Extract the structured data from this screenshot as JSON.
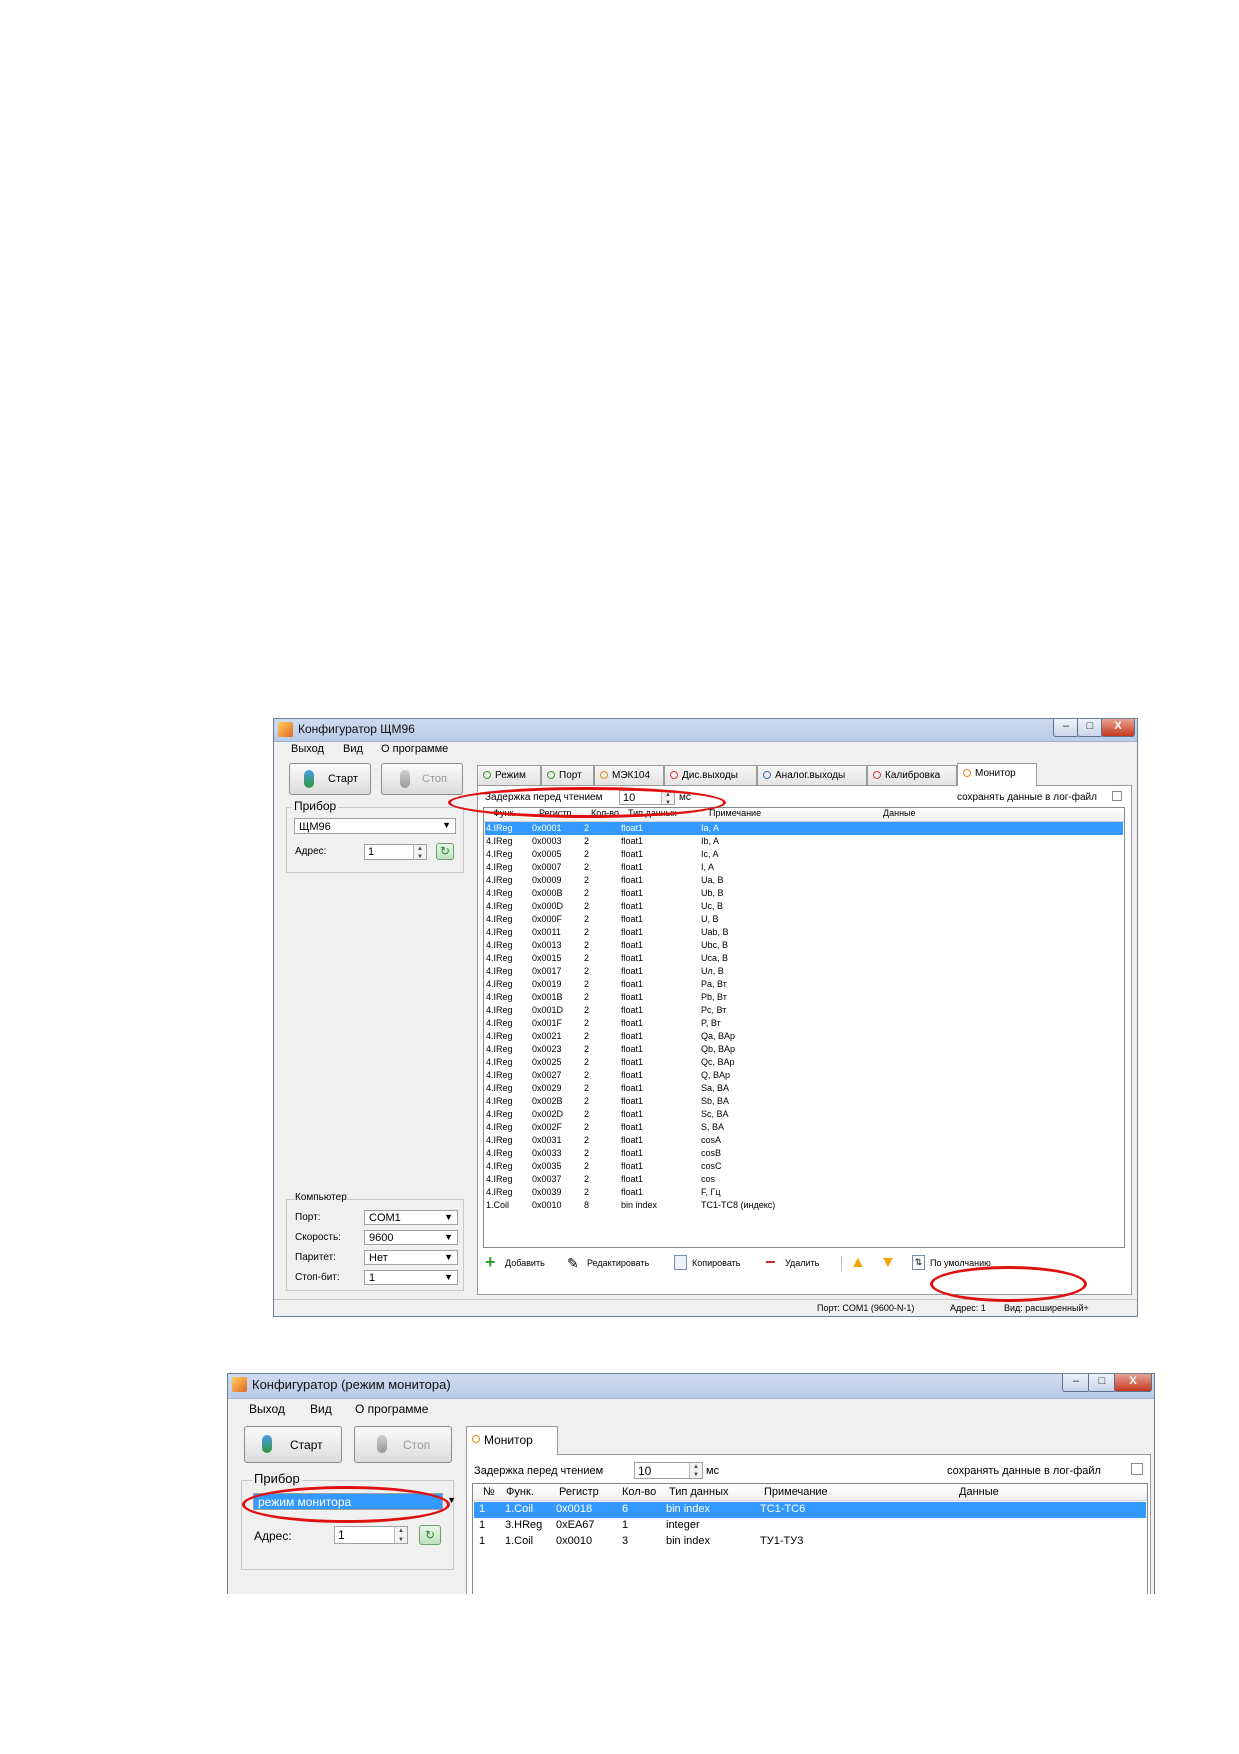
{
  "window1": {
    "title": "Конфигуратор ЩМ96",
    "controls": {
      "minimize": "–",
      "maximize": "□",
      "close": "X"
    },
    "menu": [
      "Выход",
      "Вид",
      "О программе"
    ],
    "start_label": "Старт",
    "stop_label": "Стоп",
    "device_group": "Прибор",
    "device_value": "ЩМ96",
    "address_label": "Адрес:",
    "address_value": "1",
    "computer_group": "Компьютер",
    "port_label": "Порт:",
    "port_value": "COM1",
    "speed_label": "Скорость:",
    "speed_value": "9600",
    "parity_label": "Паритет:",
    "parity_value": "Нет",
    "stopbits_label": "Стоп-бит:",
    "stopbits_value": "1",
    "tabs": [
      "Режим",
      "Порт",
      "МЭК104",
      "Дис.выходы",
      "Аналог.выходы",
      "Калибровка",
      "Монитор"
    ],
    "delay_label": "Задержка перед чтением",
    "delay_value": "10",
    "delay_unit": "мс",
    "savelog_label": "сохранять данные в лог-файл",
    "columns": [
      "Функ.",
      "Регистр",
      "Кол-во",
      "Тип данных",
      "Примечание",
      "Данные"
    ],
    "rows": [
      [
        "4.IReg",
        "0x0001",
        "2",
        "float1",
        "Ia, A",
        ""
      ],
      [
        "4.IReg",
        "0x0003",
        "2",
        "float1",
        "Ib, A",
        ""
      ],
      [
        "4.IReg",
        "0x0005",
        "2",
        "float1",
        "Ic, A",
        ""
      ],
      [
        "4.IReg",
        "0x0007",
        "2",
        "float1",
        "I, A",
        ""
      ],
      [
        "4.IReg",
        "0x0009",
        "2",
        "float1",
        "Ua, B",
        ""
      ],
      [
        "4.IReg",
        "0x000B",
        "2",
        "float1",
        "Ub, B",
        ""
      ],
      [
        "4.IReg",
        "0x000D",
        "2",
        "float1",
        "Uc, B",
        ""
      ],
      [
        "4.IReg",
        "0x000F",
        "2",
        "float1",
        "U, B",
        ""
      ],
      [
        "4.IReg",
        "0x0011",
        "2",
        "float1",
        "Uab, B",
        ""
      ],
      [
        "4.IReg",
        "0x0013",
        "2",
        "float1",
        "Ubc, B",
        ""
      ],
      [
        "4.IReg",
        "0x0015",
        "2",
        "float1",
        "Uca, B",
        ""
      ],
      [
        "4.IReg",
        "0x0017",
        "2",
        "float1",
        "Uл, B",
        ""
      ],
      [
        "4.IReg",
        "0x0019",
        "2",
        "float1",
        "Pa, Вт",
        ""
      ],
      [
        "4.IReg",
        "0x001B",
        "2",
        "float1",
        "Pb, Вт",
        ""
      ],
      [
        "4.IReg",
        "0x001D",
        "2",
        "float1",
        "Pc, Вт",
        ""
      ],
      [
        "4.IReg",
        "0x001F",
        "2",
        "float1",
        "P, Вт",
        ""
      ],
      [
        "4.IReg",
        "0x0021",
        "2",
        "float1",
        "Qa, BAp",
        ""
      ],
      [
        "4.IReg",
        "0x0023",
        "2",
        "float1",
        "Qb, BAp",
        ""
      ],
      [
        "4.IReg",
        "0x0025",
        "2",
        "float1",
        "Qc, BAp",
        ""
      ],
      [
        "4.IReg",
        "0x0027",
        "2",
        "float1",
        "Q, BAp",
        ""
      ],
      [
        "4.IReg",
        "0x0029",
        "2",
        "float1",
        "Sa, BA",
        ""
      ],
      [
        "4.IReg",
        "0x002B",
        "2",
        "float1",
        "Sb, BA",
        ""
      ],
      [
        "4.IReg",
        "0x002D",
        "2",
        "float1",
        "Sc, BA",
        ""
      ],
      [
        "4.IReg",
        "0x002F",
        "2",
        "float1",
        "S, BA",
        ""
      ],
      [
        "4.IReg",
        "0x0031",
        "2",
        "float1",
        "cosA",
        ""
      ],
      [
        "4.IReg",
        "0x0033",
        "2",
        "float1",
        "cosB",
        ""
      ],
      [
        "4.IReg",
        "0x0035",
        "2",
        "float1",
        "cosC",
        ""
      ],
      [
        "4.IReg",
        "0x0037",
        "2",
        "float1",
        "cos",
        ""
      ],
      [
        "4.IReg",
        "0x0039",
        "2",
        "float1",
        "F, Гц",
        ""
      ],
      [
        "1.Coil",
        "0x0010",
        "8",
        "bin index",
        "TC1-TC8 (индекс)",
        ""
      ]
    ],
    "selected_row": 0,
    "toolbar": {
      "add": "Добавить",
      "edit": "Редактировать",
      "copy": "Копировать",
      "delete": "Удалить",
      "default": "По умолчанию"
    },
    "status": {
      "port": "Порт: COM1 (9600-N-1)",
      "address": "Адрес: 1",
      "view": "Вид: расширенный+"
    }
  },
  "window2": {
    "title": "Конфигуратор (режим монитора)",
    "controls": {
      "minimize": "–",
      "maximize": "□",
      "close": "X"
    },
    "menu": [
      "Выход",
      "Вид",
      "О программе"
    ],
    "start_label": "Старт",
    "stop_label": "Стоп",
    "device_group": "Прибор",
    "device_value": "режим монитора",
    "address_label": "Адрес:",
    "address_value": "1",
    "tabs": [
      "Монитор"
    ],
    "delay_label": "Задержка перед чтением",
    "delay_value": "10",
    "delay_unit": "мс",
    "savelog_label": "сохранять данные в лог-файл",
    "columns": [
      "№",
      "Функ.",
      "Регистр",
      "Кол-во",
      "Тип данных",
      "Примечание",
      "Данные"
    ],
    "rows": [
      [
        "1",
        "1.Coil",
        "0x0018",
        "6",
        "bin index",
        "TC1-TC6",
        ""
      ],
      [
        "1",
        "3.HReg",
        "0xEA67",
        "1",
        "integer",
        "",
        ""
      ],
      [
        "1",
        "1.Coil",
        "0x0010",
        "3",
        "bin index",
        "TУ1-TУ3",
        ""
      ]
    ],
    "selected_row": 0
  },
  "colors": {
    "selection": "#3399ff",
    "highlight_ellipse": "#e01010"
  }
}
